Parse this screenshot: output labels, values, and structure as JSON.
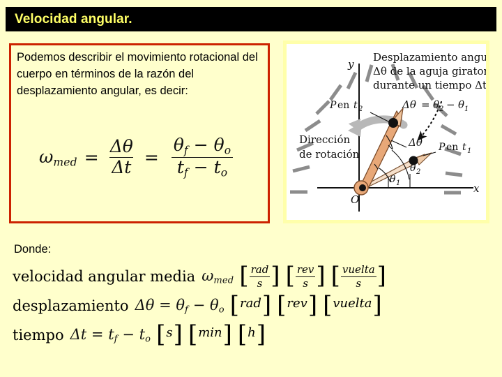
{
  "slide": {
    "background_color": "#ffffcc",
    "title": {
      "text": "Velocidad angular.",
      "bar_color": "#000000",
      "text_color": "#ffff66"
    }
  },
  "red_box": {
    "border_color": "#cc2200",
    "paragraph": "Podemos describir el movimiento rotacional del cuerpo en términos de la razón del desplazamiento angular, es decir:",
    "formula": {
      "lhs": "ω",
      "lhs_sub": "med",
      "eq1": "=",
      "frac1_num": "Δθ",
      "frac1_den": "Δt",
      "eq2": "=",
      "frac2_num_a": "θ",
      "frac2_num_a_sub": "f",
      "frac2_num_minus": "−",
      "frac2_num_b": "θ",
      "frac2_num_b_sub": "o",
      "frac2_den_a": "t",
      "frac2_den_a_sub": "f",
      "frac2_den_minus": "−",
      "frac2_den_b": "t",
      "frac2_den_b_sub": "o"
    }
  },
  "donde": {
    "heading": "Donde:",
    "lines": [
      {
        "label": "velocidad angular media",
        "symbol": "ω",
        "symbol_sub": "med",
        "units": [
          {
            "kind": "fraction",
            "num": "rad",
            "den": "s"
          },
          {
            "kind": "fraction",
            "num": "rev",
            "den": "s"
          },
          {
            "kind": "fraction",
            "num": "vuelta",
            "den": "s"
          }
        ]
      },
      {
        "label": "desplazamiento",
        "equation": "Δθ = θf − θo",
        "eq_parts": {
          "delta": "Δθ",
          "eq": "=",
          "a": "θ",
          "a_sub": "f",
          "minus": "−",
          "b": "θ",
          "b_sub": "o"
        },
        "units": [
          {
            "kind": "plain",
            "text": "rad"
          },
          {
            "kind": "plain",
            "text": "rev"
          },
          {
            "kind": "plain",
            "text": "vuelta"
          }
        ]
      },
      {
        "label": "tiempo",
        "equation": "Δt = tf − to",
        "eq_parts": {
          "delta": "Δt",
          "eq": "=",
          "a": "t",
          "a_sub": "f",
          "minus": "−",
          "b": "t",
          "b_sub": "o"
        },
        "units": [
          {
            "kind": "plain",
            "text": "s"
          },
          {
            "kind": "plain",
            "text": "min"
          },
          {
            "kind": "plain",
            "text": "h"
          }
        ]
      }
    ]
  },
  "figure": {
    "caption_line1": "Desplazamiento angular",
    "caption_line2": "Δθ de la aguja giratoria",
    "caption_line3": "durante un tiempo Δt:",
    "equation": "Δθ = θ2 − θ1",
    "equation_parts": {
      "delta": "Δθ",
      "eq": "=",
      "a": "θ",
      "a_sub": "2",
      "minus": "−",
      "b": "θ",
      "b_sub": "1"
    },
    "axis_y": "y",
    "axis_x": "x",
    "origin": "O",
    "label_p_t2_a": "P",
    "label_p_t2_b": "en",
    "label_p_t2_sub": "t",
    "label_p_t2_subnum": "2",
    "label_p_t1_a": "P",
    "label_p_t1_b": "en",
    "label_p_t1_sub": "t",
    "label_p_t1_subnum": "1",
    "direction_line1": "Dirección",
    "direction_line2": "de rotación",
    "angle_delta": "Δθ",
    "angle_theta1": "θ",
    "angle_theta1_sub": "1",
    "angle_theta2": "θ",
    "angle_theta2_sub": "2",
    "hand_color": "#e8a878",
    "tick_color": "#8c8c8c",
    "arrow_color": "#b0b0b0",
    "border_color": "#ffffaa"
  }
}
